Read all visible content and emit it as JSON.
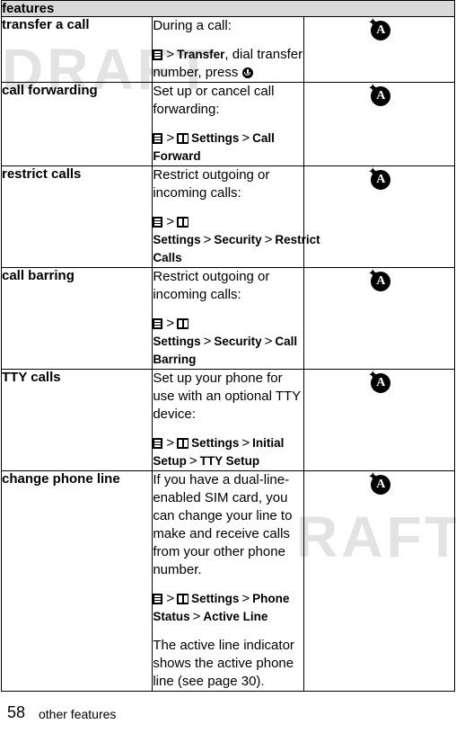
{
  "watermark": {
    "left": "DRAFT",
    "right": "RAFT"
  },
  "table": {
    "header": "features",
    "rows": [
      {
        "label": "transfer a call",
        "body": [
          {
            "type": "text",
            "text": "During a call:"
          },
          {
            "type": "nav",
            "prefix": "",
            "text": "Transfer, dial transfer number, press"
          }
        ],
        "icon": "network-a-icon"
      },
      {
        "label": "call forwarding",
        "body": [
          {
            "type": "text",
            "text": "Set up or cancel call forwarding:"
          },
          {
            "type": "nav",
            "path": "Settings > Call Forward"
          }
        ],
        "icon": "network-a-icon"
      },
      {
        "label": "restrict calls",
        "body": [
          {
            "type": "text",
            "text": "Restrict outgoing or incoming calls:"
          },
          {
            "type": "nav",
            "path": "Settings > Security > Restrict Calls"
          }
        ],
        "icon": "network-a-icon"
      },
      {
        "label": "call barring",
        "body": [
          {
            "type": "text",
            "text": "Restrict outgoing or incoming calls:"
          },
          {
            "type": "nav",
            "path": "Settings > Security > Call Barring"
          }
        ],
        "icon": "network-a-icon"
      },
      {
        "label": "TTY calls",
        "body": [
          {
            "type": "text",
            "text": "Set up your phone for use with an optional TTY device:"
          },
          {
            "type": "nav",
            "path": "Settings > Initial Setup > TTY Setup"
          }
        ],
        "icon": "network-a-icon"
      },
      {
        "label": "change phone line",
        "body": [
          {
            "type": "text",
            "text": "If you have a dual-line-enabled SIM card, you can change your line to make and receive calls from your other phone number."
          },
          {
            "type": "nav",
            "path": "Settings > Phone Status > Active Line"
          },
          {
            "type": "text",
            "text": "The active line indicator shows the active phone line (see page 30)."
          }
        ],
        "icon": "network-a-icon"
      }
    ]
  },
  "row_texts": {
    "r1_c1": "transfer a call",
    "r1_p1": "During a call:",
    "r1_p2a": "Transfer",
    "r1_p2b": ", dial transfer number, press",
    "r2_c1": "call forwarding",
    "r2_p1": "Set up or cancel call forwarding:",
    "r2_settings": "Settings",
    "r2_last": "Call Forward",
    "r3_c1": "restrict calls",
    "r3_p1": "Restrict outgoing or incoming calls:",
    "r3_settings": "Settings",
    "r3_mid": "Security",
    "r3_last": "Restrict Calls",
    "r4_c1": "call barring",
    "r4_p1": "Restrict outgoing or incoming calls:",
    "r4_settings": "Settings",
    "r4_mid": "Security",
    "r4_last": "Call Barring",
    "r5_c1": "TTY calls",
    "r5_p1": "Set up your phone for use with an optional TTY device:",
    "r5_settings": "Settings",
    "r5_mid": "Initial Setup",
    "r5_last": "TTY Setup",
    "r6_c1": "change phone line",
    "r6_p1": "If you have a dual-line-enabled SIM card, you can change your line to make and receive calls from your other phone number.",
    "r6_settings": "Settings",
    "r6_mid": "Phone Status",
    "r6_last": "Active Line",
    "r6_p3": "The active line indicator shows the active phone line (see page 30)."
  },
  "separator": ">",
  "icon_letter": "A",
  "footer": {
    "page_number": "58",
    "text": "other features"
  }
}
